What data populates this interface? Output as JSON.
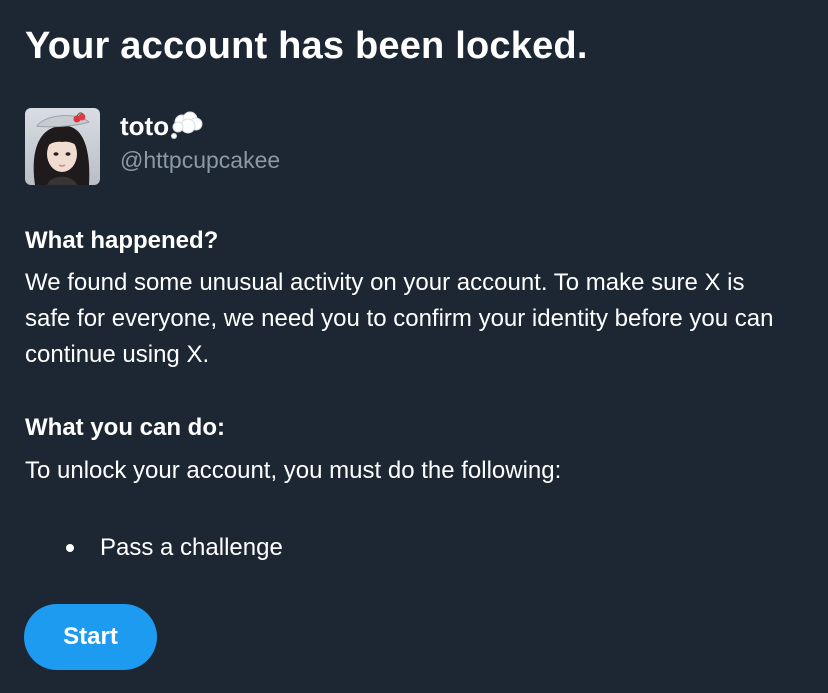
{
  "page": {
    "title": "Your account has been locked."
  },
  "profile": {
    "display_name": "toto",
    "name_emoji_icon": "thought-balloon-icon",
    "handle": "@httpcupcakee",
    "avatar": "avatar"
  },
  "what_happened": {
    "heading": "What happened?",
    "body": "We found some unusual activity on your account. To make sure X is safe for everyone, we need you to confirm your identity before you can continue using X."
  },
  "what_you_can_do": {
    "heading": "What you can do:",
    "body": "To unlock your account, you must do the following:",
    "steps": [
      {
        "label": "Pass a challenge"
      }
    ]
  },
  "actions": {
    "start_label": "Start"
  },
  "colors": {
    "background": "#1c2733",
    "text": "#ffffff",
    "secondary_text": "#8b98a5",
    "accent": "#1d9bf0"
  }
}
